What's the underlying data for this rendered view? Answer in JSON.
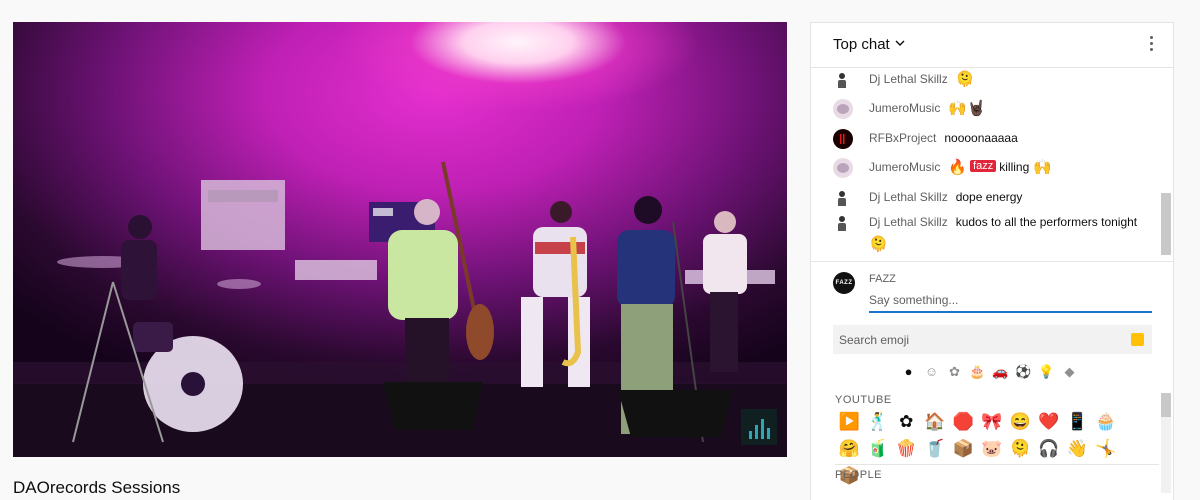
{
  "video": {
    "title": "DAOrecords Sessions"
  },
  "chat": {
    "header_title": "Top chat",
    "messages": [
      {
        "author": "Dj Lethal Skillz",
        "text": "",
        "emojis": [
          "🫠"
        ],
        "avatar": "lethal"
      },
      {
        "author": "JumeroMusic",
        "text": "",
        "emojis": [
          "🙌",
          "🤘🏿"
        ],
        "avatar": "jumero"
      },
      {
        "author": "RFBxProject",
        "text": "noooonaaaaa",
        "emojis": [],
        "avatar": "rfb"
      },
      {
        "author": "JumeroMusic",
        "text": "killing",
        "emojis": [
          "🔥",
          "🙌"
        ],
        "badge": "fazz",
        "avatar": "jumero"
      },
      {
        "author": "Dj Lethal Skillz",
        "text": "dope energy",
        "emojis": [],
        "avatar": "lethal"
      },
      {
        "author": "Dj Lethal Skillz",
        "text": "kudos to all the performers tonight",
        "emojis": [
          "🫠"
        ],
        "avatar": "lethal"
      }
    ],
    "compose": {
      "avatar_text": "FAZZ",
      "user_name": "FAZZ",
      "placeholder": "Say something..."
    },
    "emoji_picker": {
      "search_label": "Search emoji",
      "search_color": "#ffc107",
      "categories": [
        "●",
        "☺",
        "✿",
        "🎂",
        "🚗",
        "⚽",
        "💡",
        "◆"
      ],
      "sections": [
        {
          "label": "YOUTUBE",
          "emojis": [
            "▶️",
            "🕺",
            "✿",
            "🏠",
            "🛑",
            "🎀",
            "😄",
            "❤️",
            "📱",
            "🧁",
            "🤗",
            "🧃",
            "🍿",
            "🥤",
            "📦",
            "🐷",
            "🫠",
            "🎧",
            "👋",
            "🤸",
            "📦"
          ]
        },
        {
          "label": "PEOPLE",
          "emojis": []
        }
      ]
    }
  },
  "colors": {
    "accent": "#1a73c8",
    "stage_magenta": "#d428c8",
    "badge_red": "#e3253a"
  }
}
